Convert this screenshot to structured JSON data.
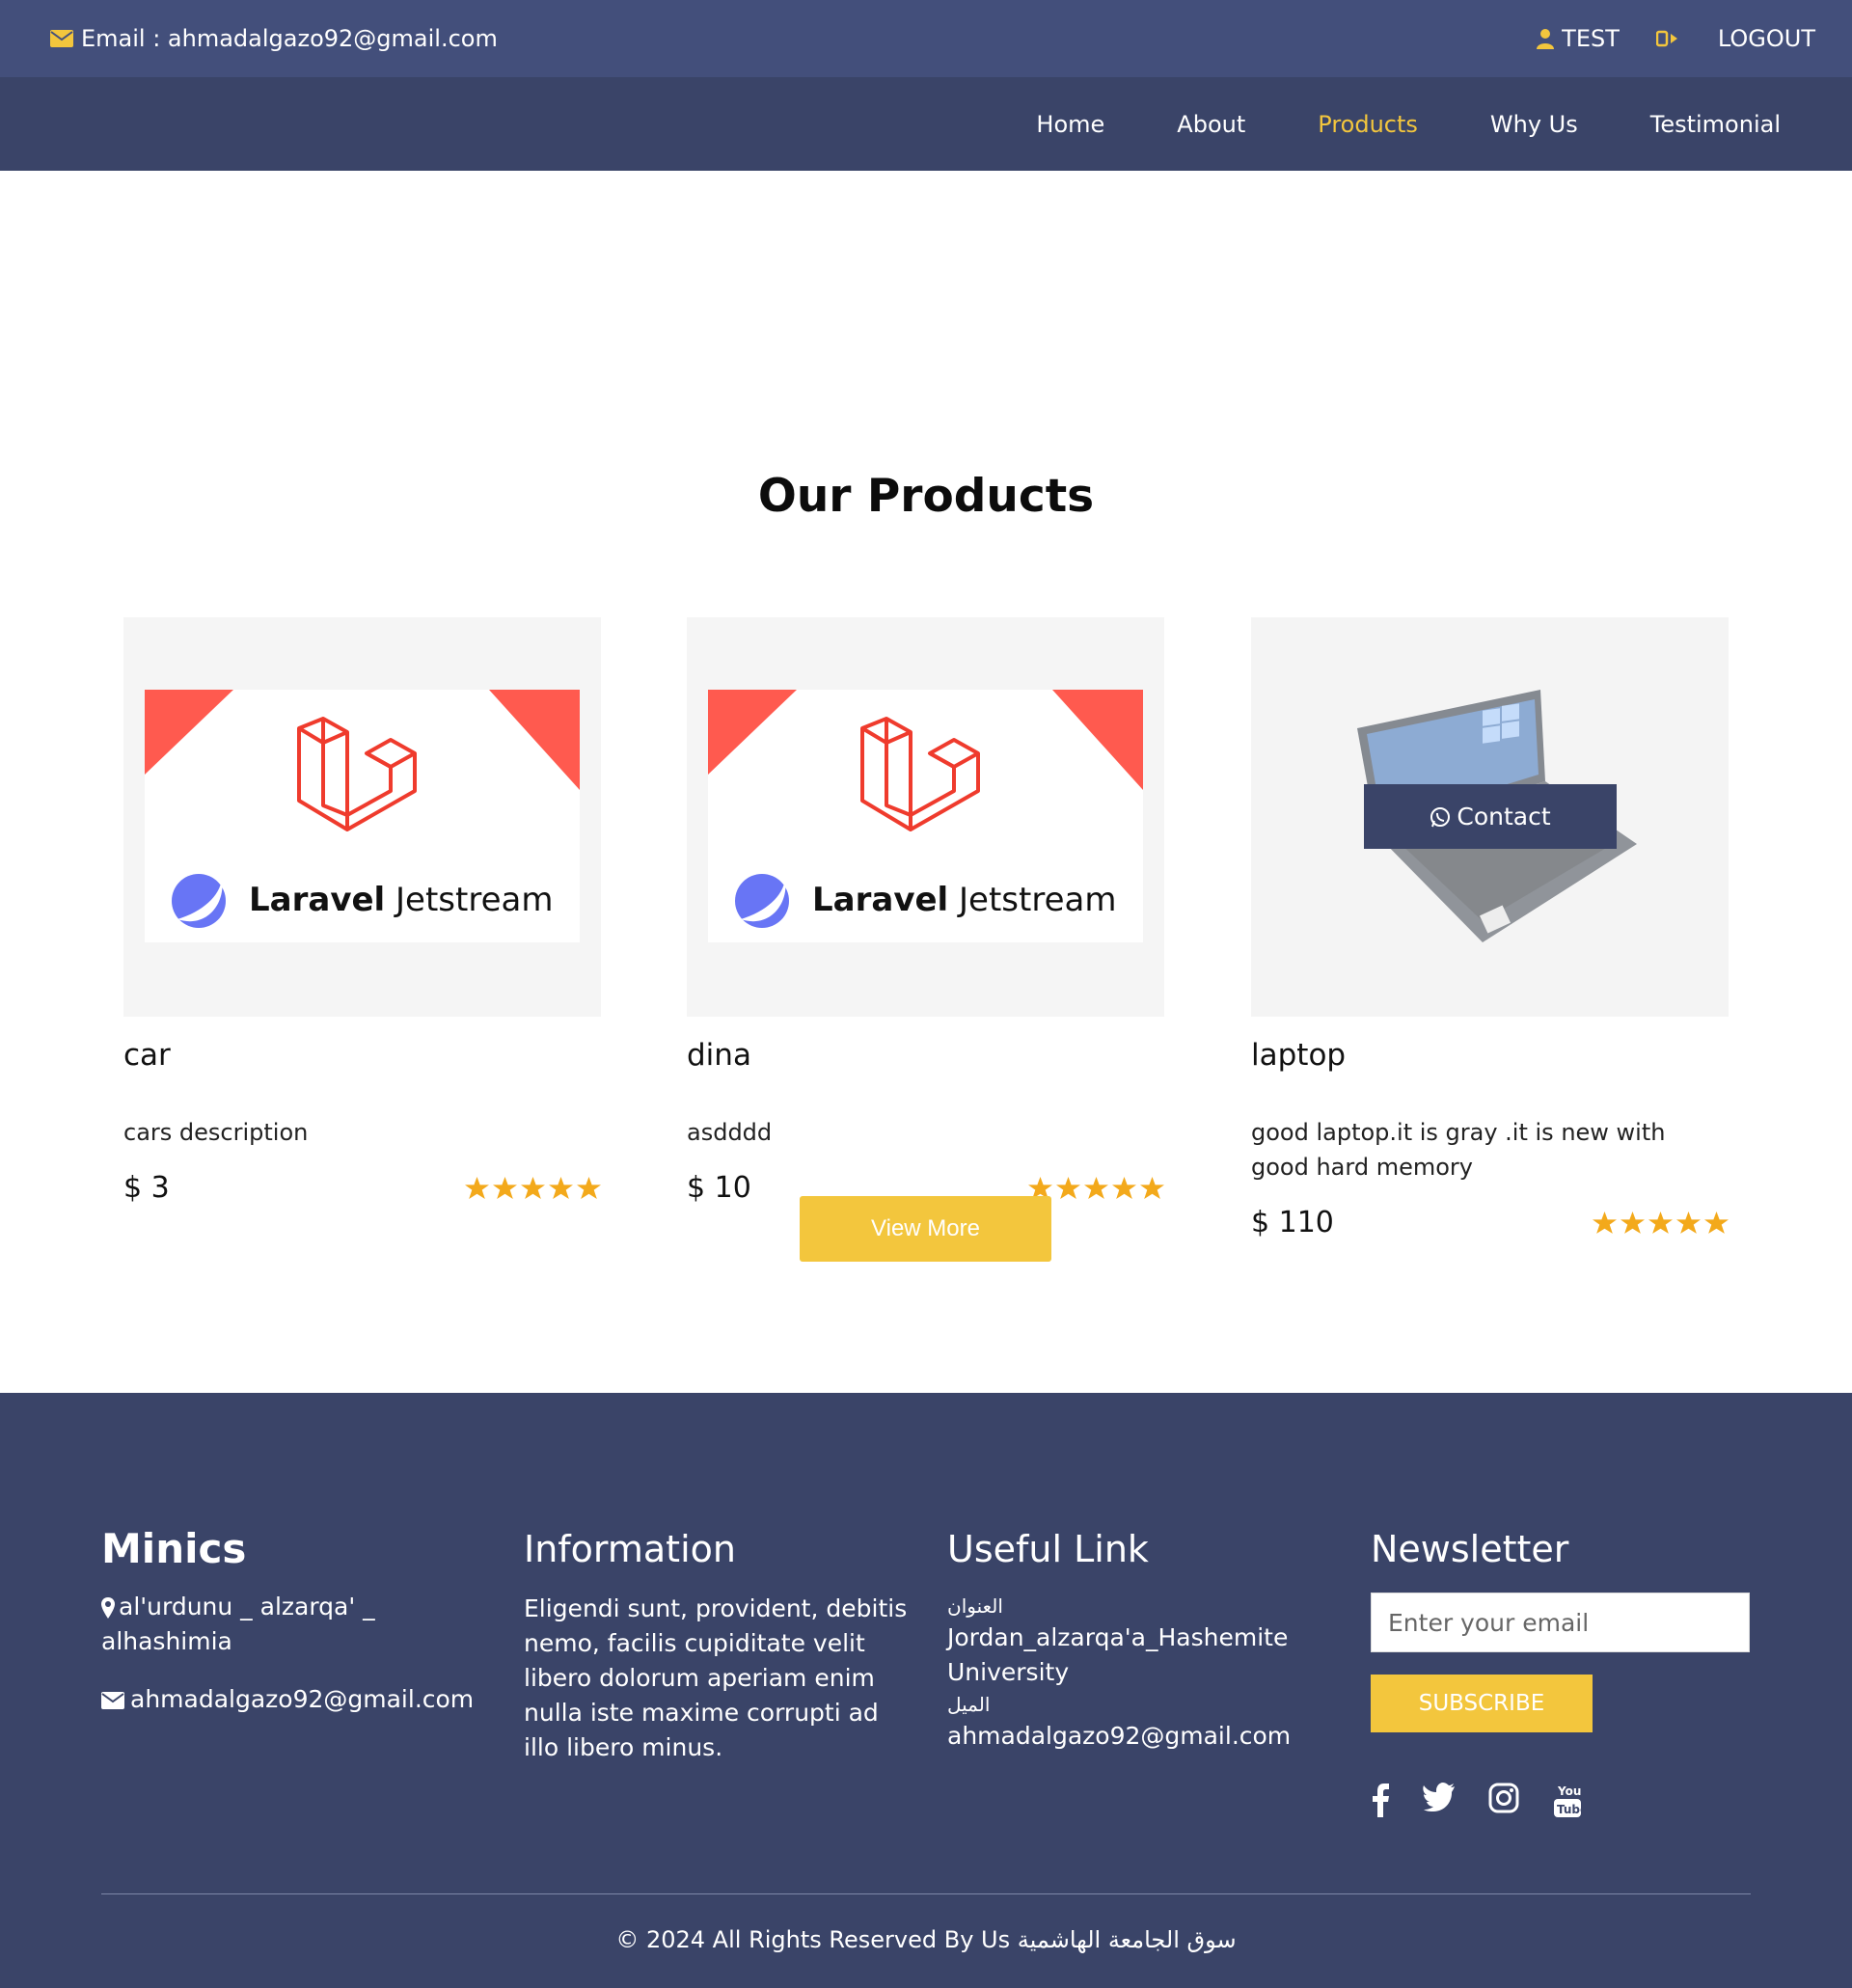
{
  "topbar": {
    "email": "Email : ahmadalgazo92@gmail.com",
    "user": "TEST",
    "logout": "LOGOUT"
  },
  "nav": {
    "items": [
      "Home",
      "About",
      "Products",
      "Why Us",
      "Testimonial"
    ],
    "active": "Products"
  },
  "products": {
    "heading": "Our Products",
    "items": [
      {
        "name": "car",
        "description": "cars description",
        "price": "$ 3",
        "rating": 5,
        "image_brand": "Laravel",
        "image_brand2": "Jetstream"
      },
      {
        "name": "dina",
        "description": "asdddd",
        "price": "$ 10",
        "rating": 5,
        "image_brand": "Laravel",
        "image_brand2": "Jetstream"
      },
      {
        "name": "laptop",
        "description": "good laptop.it is gray .it is new with good hard memory",
        "price": "$ 110",
        "rating": 5
      }
    ],
    "contact_label": "Contact",
    "view_more": "View More"
  },
  "footer": {
    "brand": "Minics",
    "address": "al'urdunu _ alzarqa' _ alhashimia",
    "email": "ahmadalgazo92@gmail.com",
    "info_title": "Information",
    "info_text": "Eligendi sunt, provident, debitis nemo, facilis cupiditate velit libero dolorum aperiam enim nulla iste maxime corrupti ad illo libero minus.",
    "links_title": "Useful Link",
    "link_address_label": "العنوان",
    "link_address": "Jordan_alzarqa'a_Hashemite University",
    "link_email_label": "الميل",
    "link_email": "ahmadalgazo92@gmail.com",
    "newsletter_title": "Newsletter",
    "newsletter_placeholder": "Enter your email",
    "subscribe": "SUBSCRIBE",
    "social": [
      "facebook-icon",
      "twitter-icon",
      "instagram-icon",
      "youtube-icon"
    ],
    "copyright": "© 2024 All Rights Reserved By Us سوق الجامعة الهاشمية"
  },
  "colors": {
    "accent": "#f3c63d",
    "topbar": "#434f7b",
    "nav": "#3a4468",
    "star": "#f3a91b",
    "laravel_red": "#ef3b2d"
  }
}
